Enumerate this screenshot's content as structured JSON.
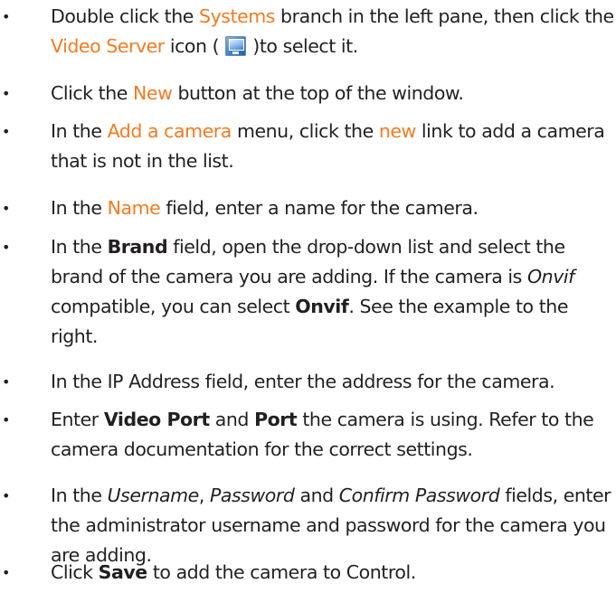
{
  "bullet": "•",
  "accent_color": "#f47b20",
  "steps": [
    {
      "segments": [
        {
          "t": "Double click the "
        },
        {
          "t": "Systems",
          "s": "orange"
        },
        {
          "t": " branch in the left pane, then click the "
        },
        {
          "t": "Video Server",
          "s": "orange"
        },
        {
          "t": " icon ( "
        },
        {
          "icon": "video-server-icon"
        },
        {
          "t": " )to select it."
        }
      ]
    },
    {
      "segments": [
        {
          "t": "Click the "
        },
        {
          "t": "New",
          "s": "orange"
        },
        {
          "t": " button at the top of the window."
        }
      ]
    },
    {
      "segments": [
        {
          "t": "In the "
        },
        {
          "t": "Add a camera",
          "s": "orange"
        },
        {
          "t": " menu, click the "
        },
        {
          "t": "new",
          "s": "orange"
        },
        {
          "t": " link to add a camera that is not in the list."
        }
      ]
    },
    {
      "segments": [
        {
          "t": "In the "
        },
        {
          "t": "Name",
          "s": "orange"
        },
        {
          "t": " field, enter a name for the camera."
        }
      ]
    },
    {
      "segments": [
        {
          "t": "In the "
        },
        {
          "t": "Brand",
          "s": "bold"
        },
        {
          "t": " field, open the drop-down list and select the brand of the camera you are adding. If the camera is "
        },
        {
          "t": "Onvif",
          "s": "italic"
        },
        {
          "t": " compatible, you can select "
        },
        {
          "t": "Onvif",
          "s": "bold"
        },
        {
          "t": ". See the example to the right."
        }
      ]
    },
    {
      "segments": [
        {
          "t": "In the IP Address field, enter the address for the camera."
        }
      ]
    },
    {
      "segments": [
        {
          "t": "Enter "
        },
        {
          "t": "Video Port",
          "s": "bold"
        },
        {
          "t": " and "
        },
        {
          "t": "Port",
          "s": "bold"
        },
        {
          "t": " the camera is using. Refer to the camera documentation for the correct settings."
        }
      ]
    },
    {
      "segments": [
        {
          "t": "In the "
        },
        {
          "t": "Username",
          "s": "italic"
        },
        {
          "t": ", "
        },
        {
          "t": "Password",
          "s": "italic"
        },
        {
          "t": " and "
        },
        {
          "t": "Confirm Password",
          "s": "italic"
        },
        {
          "t": " fields, enter the administrator username and password for the camera you are adding."
        }
      ]
    },
    {
      "segments": [
        {
          "t": "Click "
        },
        {
          "t": "Save",
          "s": "bold"
        },
        {
          "t": " to add the camera to Control."
        }
      ]
    }
  ]
}
